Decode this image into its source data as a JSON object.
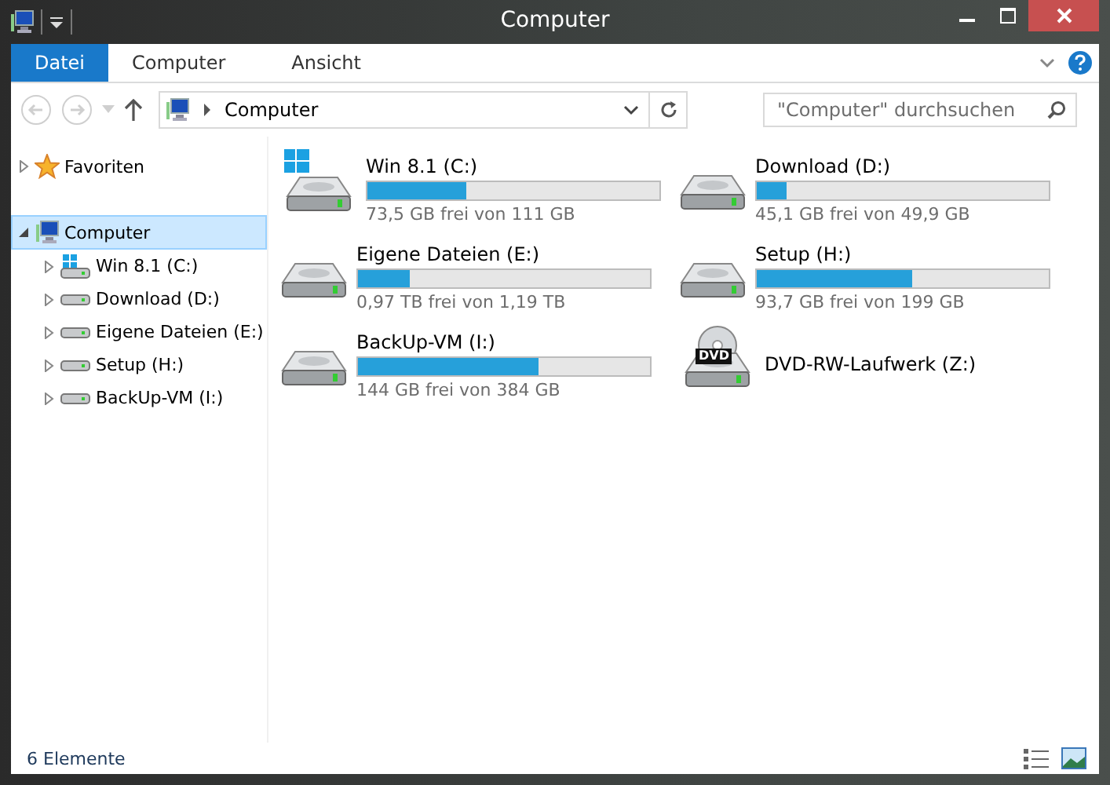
{
  "window": {
    "title": "Computer"
  },
  "ribbon": {
    "tabs": [
      {
        "label": "Datei",
        "selected": true
      },
      {
        "label": "Computer",
        "selected": false
      },
      {
        "label": "Ansicht",
        "selected": false
      }
    ]
  },
  "address_bar": {
    "path": [
      "Computer"
    ],
    "search": {
      "placeholder": "\"Computer\" durchsuchen"
    }
  },
  "sidebar": {
    "items": [
      {
        "label": "Favoriten",
        "kind": "favorites",
        "expanded": false,
        "selected": false
      },
      {
        "label": "Computer",
        "kind": "computer",
        "expanded": true,
        "selected": true,
        "children": [
          {
            "label": "Win 8.1 (C:)",
            "kind": "system",
            "expanded": false,
            "selected": false
          },
          {
            "label": "Download (D:)",
            "kind": "drive",
            "expanded": false,
            "selected": false
          },
          {
            "label": "Eigene Dateien (E:)",
            "kind": "drive",
            "expanded": false,
            "selected": false
          },
          {
            "label": "Setup (H:)",
            "kind": "drive",
            "expanded": false,
            "selected": false
          },
          {
            "label": "BackUp-VM (I:)",
            "kind": "drive",
            "expanded": false,
            "selected": false
          }
        ]
      }
    ]
  },
  "drives": [
    {
      "name": "Win 8.1 (C:)",
      "kind": "system",
      "level": 0.34,
      "free": "73,5 GB frei von 111 GB"
    },
    {
      "name": "Download (D:)",
      "kind": "drive",
      "level": 0.1,
      "free": "45,1 GB frei von 49,9 GB"
    },
    {
      "name": "Eigene Dateien (E:)",
      "kind": "drive",
      "level": 0.18,
      "free": "0,97 TB frei von 1,19 TB"
    },
    {
      "name": "Setup (H:)",
      "kind": "drive",
      "level": 0.53,
      "free": "93,7 GB frei von 199 GB"
    },
    {
      "name": "BackUp-VM (I:)",
      "kind": "drive",
      "level": 0.62,
      "free": "144 GB frei von 384 GB"
    },
    {
      "name": "DVD-RW-Laufwerk (Z:)",
      "kind": "dvd",
      "badge": "DVD"
    }
  ],
  "status_bar": {
    "count": "6 Elemente"
  }
}
